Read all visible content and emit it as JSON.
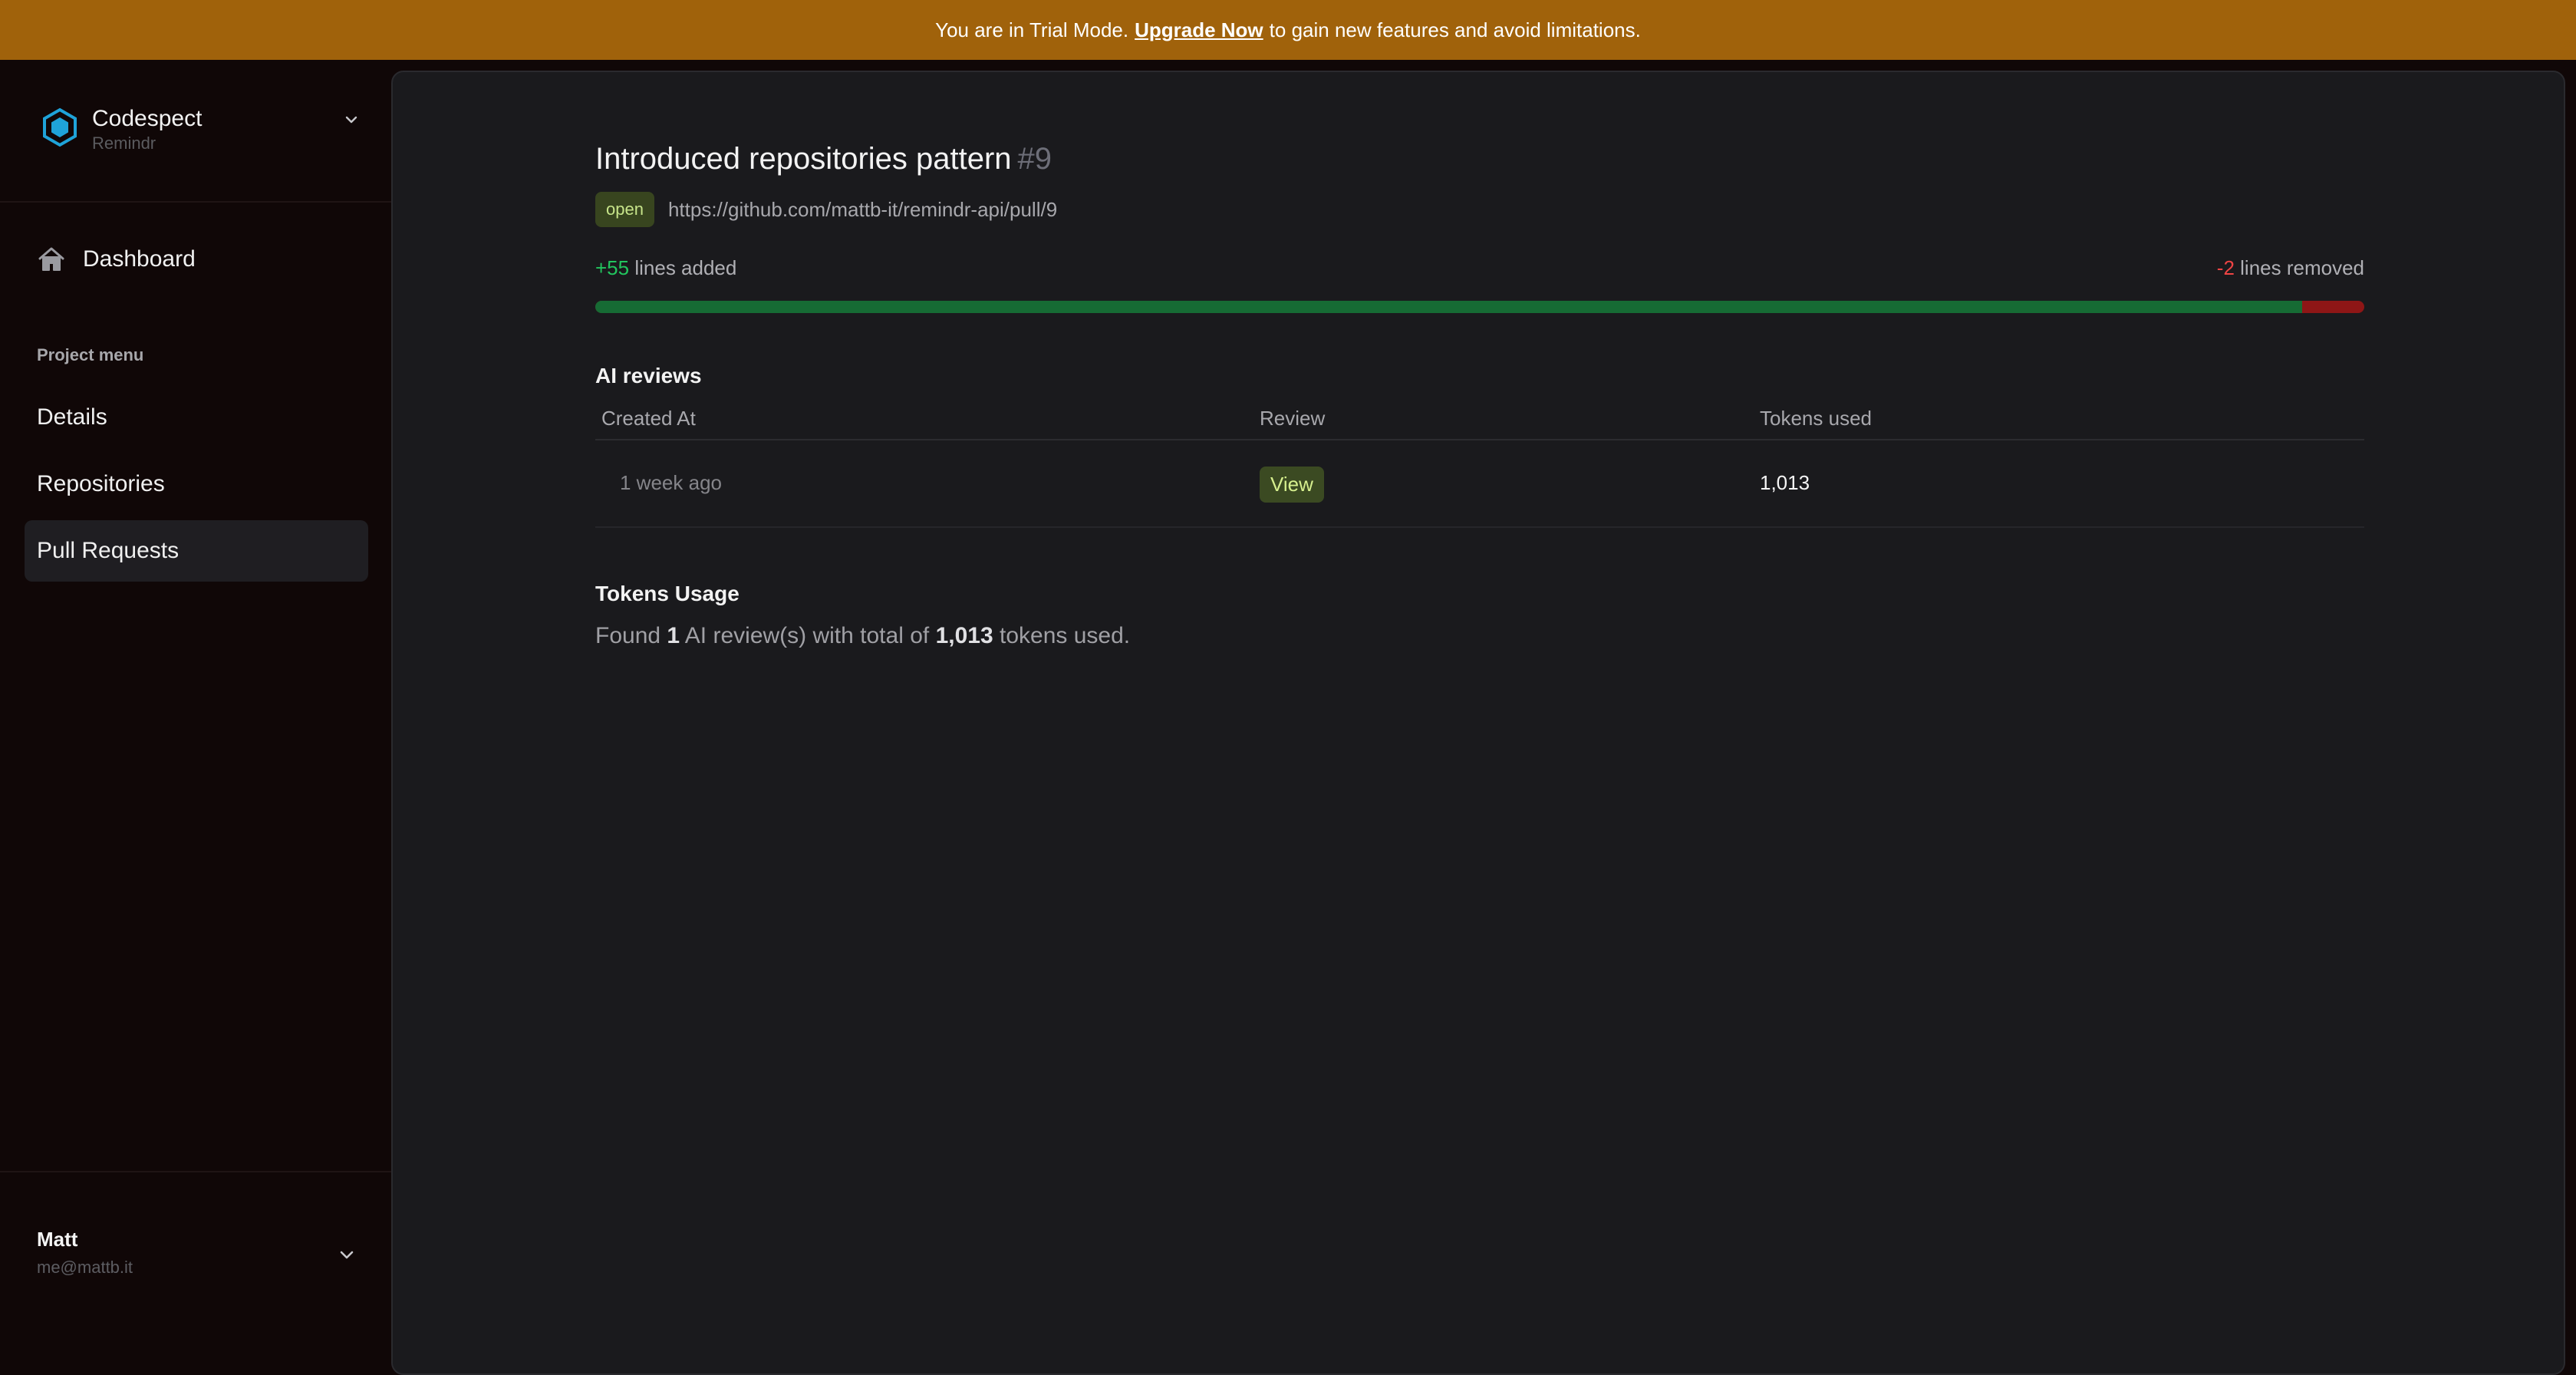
{
  "banner": {
    "prefix": "You are in Trial Mode.",
    "link": "Upgrade Now",
    "suffix": "to gain new features and avoid limitations."
  },
  "sidebar": {
    "brand_name": "Codespect",
    "brand_sub": "Remindr",
    "dashboard_label": "Dashboard",
    "section_label": "Project menu",
    "items": [
      {
        "label": "Details",
        "active": false
      },
      {
        "label": "Repositories",
        "active": false
      },
      {
        "label": "Pull Requests",
        "active": true
      }
    ],
    "user": {
      "name": "Matt",
      "email": "me@mattb.it"
    }
  },
  "pull_request": {
    "title": "Introduced repositories pattern",
    "number": "#9",
    "status": "open",
    "url": "https://github.com/mattb-it/remindr-api/pull/9",
    "added_count": "+55",
    "added_label": "lines added",
    "removed_count": "-2",
    "removed_label": "lines removed",
    "added_fraction": 0.965
  },
  "ai_reviews": {
    "title": "AI reviews",
    "columns": [
      "Created At",
      "Review",
      "Tokens used"
    ],
    "rows": [
      {
        "created": "1 week ago",
        "review": "View",
        "tokens": "1,013"
      }
    ]
  },
  "tokens_usage": {
    "title": "Tokens Usage",
    "found": "Found",
    "count": "1",
    "middle": "AI review(s) with total of",
    "total": "1,013",
    "end": "tokens used."
  },
  "colors": {
    "banner": "#a0620b",
    "added": "#22c55e",
    "removed": "#ef4444",
    "accent_logo": "#1fa3d9"
  }
}
